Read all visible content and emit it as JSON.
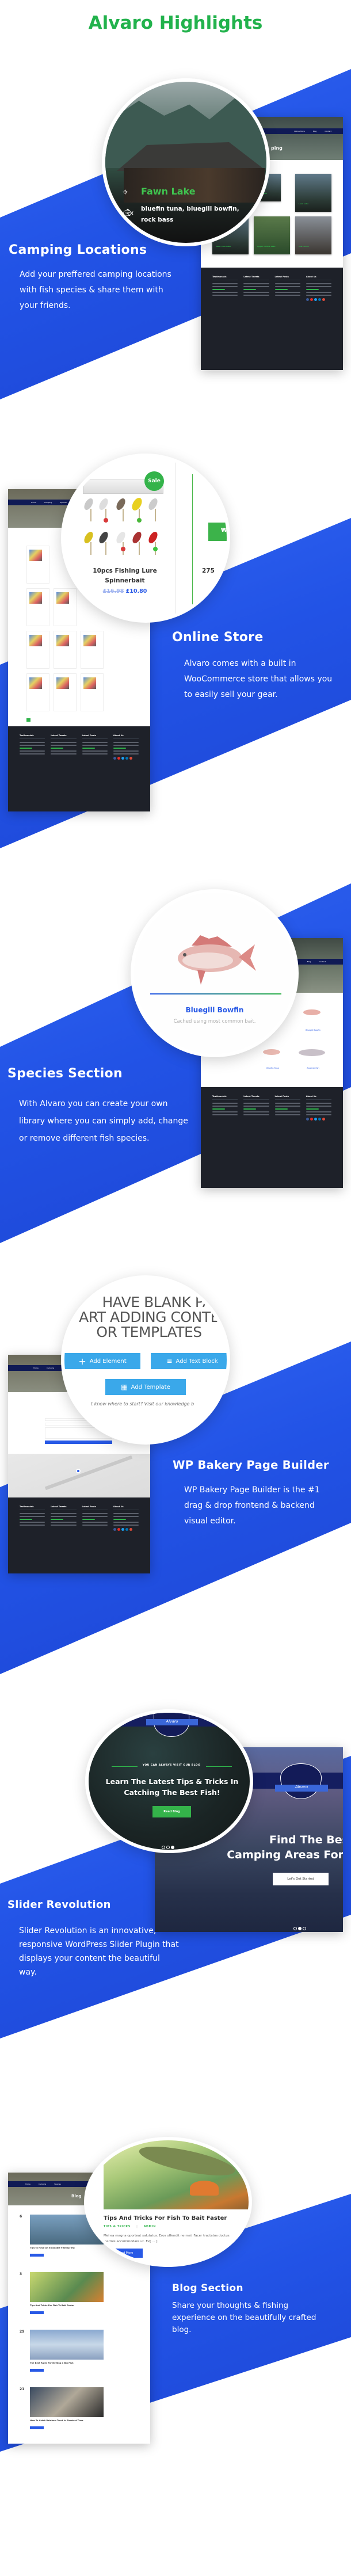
{
  "title": "Alvaro Highlights",
  "colors": {
    "accent_green": "#22b24c",
    "accent_blue": "#2859e6",
    "band_blue": "#2253e6",
    "footer_dark": "#1e2129",
    "vc_blue": "#3aa8ea"
  },
  "footer_headings": [
    "Testimonials",
    "Latest Tweets",
    "Latest Posts",
    "About Us"
  ],
  "mock_nav": [
    "Home",
    "Camping",
    "Species",
    "Online Store",
    "Blog",
    "Contact"
  ],
  "camping": {
    "heading": "Camping Locations",
    "text": "Add your preffered camping locations with fish species & share them with your friends.",
    "lake_name": "Fawn Lake",
    "fish_list": "bluefin tuna, bluegill bowfin, rock bass",
    "location_icon": "map-pin-icon",
    "fish_icon": "fish-icon",
    "mock_title": "ping",
    "tiles": [
      "Dark Lake",
      "Loon Lake",
      "West Twin Lake",
      "Upper Collins Lake",
      "Clark Lake"
    ]
  },
  "store": {
    "heading": "Online Store",
    "text": "Alvaro comes with a built in WooCommerce store that allows you to easily sell your gear.",
    "badge": "Sale",
    "product_name": "10pcs Fishing Lure Spinnerbait",
    "old_price": "£16.98",
    "price": "£10.80",
    "next_price_partial": "275",
    "cart_icon": "cart-icon"
  },
  "species": {
    "heading": "Species Section",
    "text": "With Alvaro you can create your own library where you can simply add, change or remove different fish species.",
    "fish_name": "Bluegill Bowfin",
    "fish_desc": "Cached using most common bait.",
    "mock_fish": [
      "Bluegill Bowfin",
      "Bluefin Tuna",
      "Another fish"
    ]
  },
  "builder": {
    "heading": "WP Bakery Page Builder",
    "text": "WP Bakery Page Builder is the #1 drag & drop frontend & backend visual editor.",
    "lines": [
      "HAVE BLANK PA",
      "ART ADDING CONTE",
      "OR TEMPLATES"
    ],
    "add_element": "Add Element",
    "add_text_block": "Add Text Block",
    "add_template": "Add Template",
    "hint": "t know where to start? Visit our knowledge b"
  },
  "slider": {
    "heading": "Slider Revolution",
    "text": "Slider Revolution  is an innovative, responsive WordPress Slider Plugin that displays your content the beautiful way.",
    "kicker": "YOU CAN ALWAYS VISIT OUR BLOG",
    "slide_title": "Learn The Latest Tips & Tricks In Catching The Best Fish!",
    "read_blog": "Read Blog",
    "logo_text": "Alvaro",
    "slide2_line1": "Find The Best",
    "slide2_line2": "Camping Areas For",
    "slide2_button": "Let's Get Started",
    "active_dot_slide1": 3,
    "active_dot_slide2": 2
  },
  "blog": {
    "heading": "Blog Section",
    "text": "Share your thoughts & fishing experience on the beautifully crafted blog.",
    "post_title": "Tips And Tricks For Fish To Bait Faster",
    "category": "TIPS & TRICKS",
    "author": "ADMIN",
    "excerpt": "Mei ea magna oporteat salutatus. Eros offendit ne mei. Facer tractatos doctus inermis accommodare ut. Ex[ ... ]",
    "read_more": "Read More",
    "mock_title": "Blog",
    "posts": [
      {
        "day": "6",
        "title": "Tips to Have An Enjoyable Fishing Trip"
      },
      {
        "day": "3",
        "title": "Tips And Tricks For Fish To Bait Faster"
      },
      {
        "day": "29",
        "title": "The Best Rules For Netting a Big Fish"
      },
      {
        "day": "21",
        "title": "How To Catch Rainbow Trout In Shortest Time"
      }
    ]
  }
}
